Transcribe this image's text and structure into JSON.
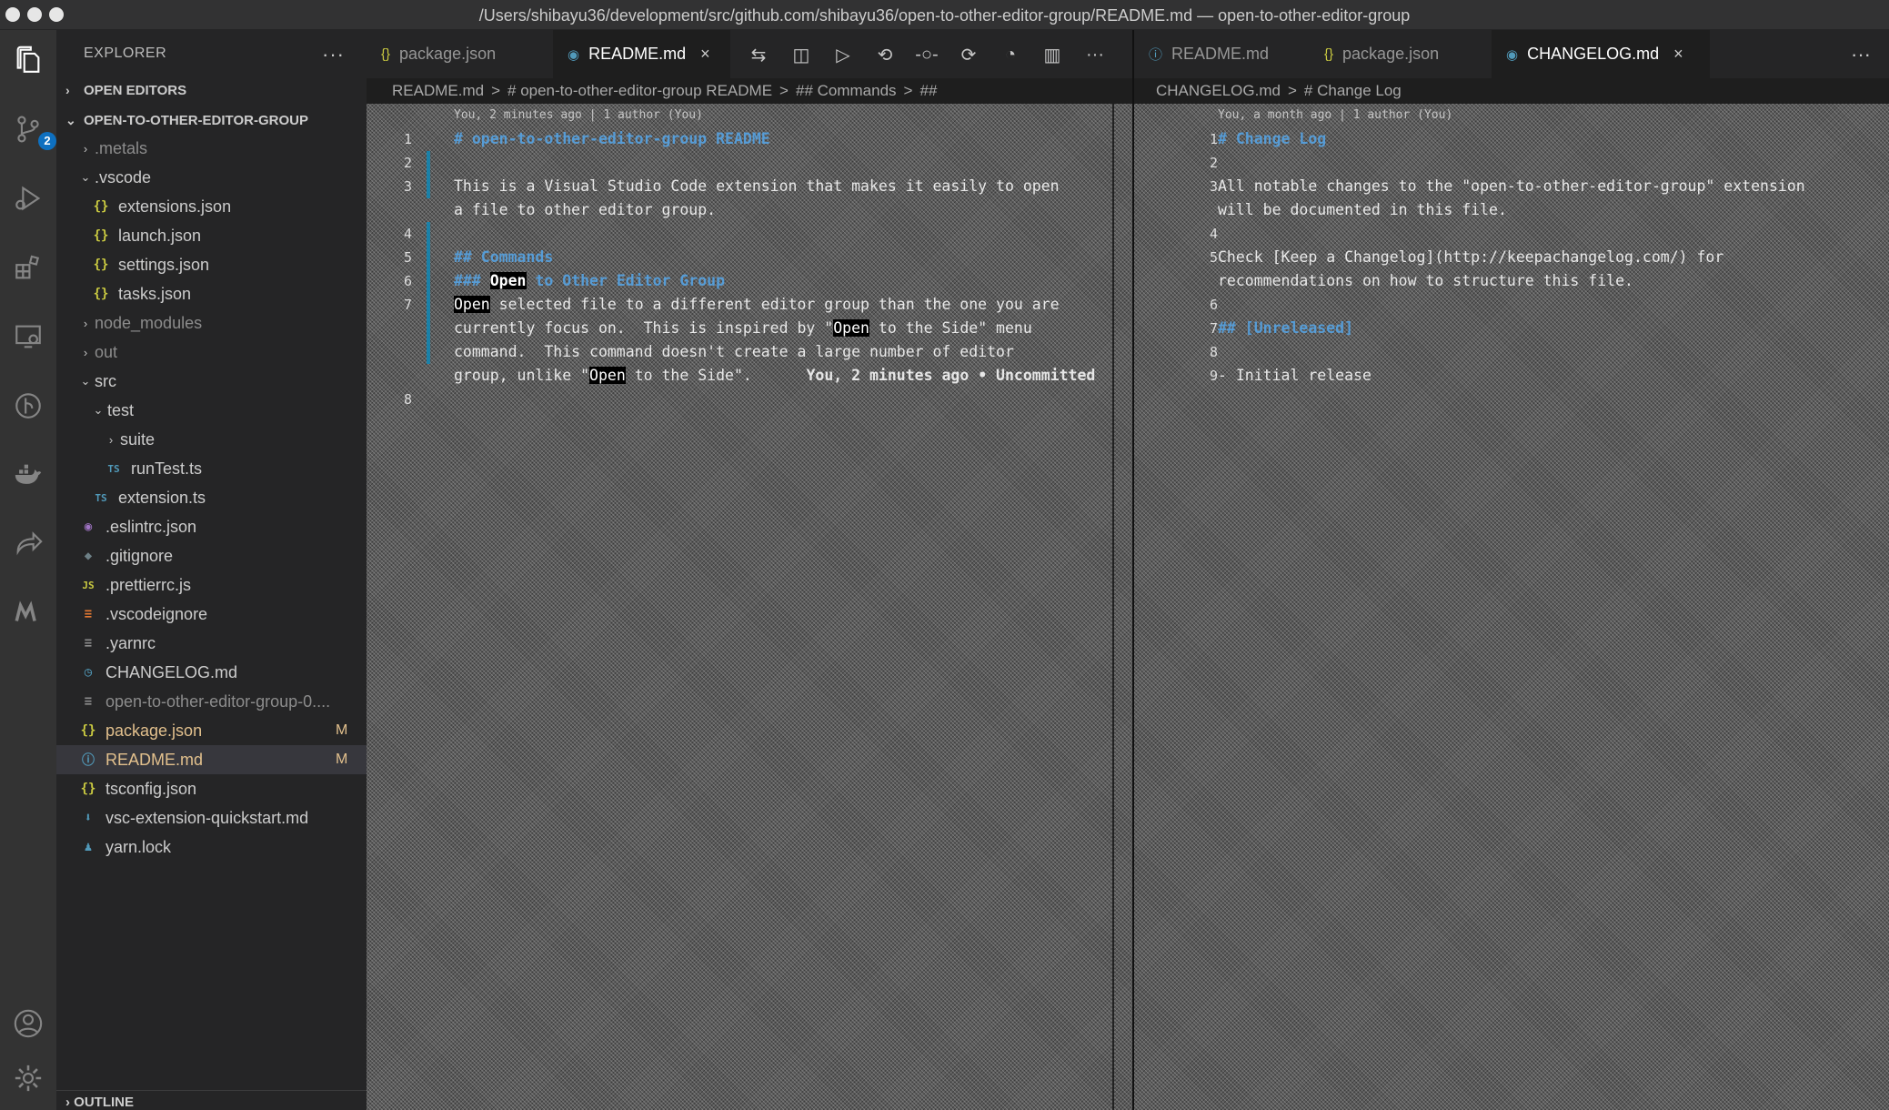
{
  "window": {
    "title": "/Users/shibayu36/development/src/github.com/shibayu36/open-to-other-editor-group/README.md — open-to-other-editor-group"
  },
  "activity_bar": {
    "scm_badge": "2",
    "icons": [
      "files-icon",
      "source-control-icon",
      "run-debug-icon",
      "extensions-icon",
      "remote-explorer-icon",
      "gitlens-icon",
      "docker-icon",
      "live-share-icon",
      "markdown-icon",
      "account-icon",
      "settings-gear-icon"
    ]
  },
  "sidebar": {
    "header": "EXPLORER",
    "more": "···",
    "open_editors": "OPEN EDITORS",
    "folder": "OPEN-TO-OTHER-EDITOR-GROUP",
    "outline": "OUTLINE",
    "tree": [
      {
        "label": ".metals",
        "indent": 1,
        "kind": "folder",
        "twisty": "›",
        "icon": "",
        "muted": true,
        "status": ""
      },
      {
        "label": ".vscode",
        "indent": 1,
        "kind": "folder",
        "twisty": "⌄",
        "icon": "",
        "muted": false,
        "status": ""
      },
      {
        "label": "extensions.json",
        "indent": 2,
        "kind": "json",
        "twisty": "",
        "icon": "{}",
        "muted": false,
        "status": ""
      },
      {
        "label": "launch.json",
        "indent": 2,
        "kind": "json",
        "twisty": "",
        "icon": "{}",
        "muted": false,
        "status": ""
      },
      {
        "label": "settings.json",
        "indent": 2,
        "kind": "json",
        "twisty": "",
        "icon": "{}",
        "muted": false,
        "status": ""
      },
      {
        "label": "tasks.json",
        "indent": 2,
        "kind": "json",
        "twisty": "",
        "icon": "{}",
        "muted": false,
        "status": ""
      },
      {
        "label": "node_modules",
        "indent": 1,
        "kind": "folder",
        "twisty": "›",
        "icon": "",
        "muted": true,
        "status": ""
      },
      {
        "label": "out",
        "indent": 1,
        "kind": "folder",
        "twisty": "›",
        "icon": "",
        "muted": true,
        "status": ""
      },
      {
        "label": "src",
        "indent": 1,
        "kind": "folder",
        "twisty": "⌄",
        "icon": "",
        "muted": false,
        "status": ""
      },
      {
        "label": "test",
        "indent": 2,
        "kind": "folder",
        "twisty": "⌄",
        "icon": "",
        "muted": false,
        "status": ""
      },
      {
        "label": "suite",
        "indent": 3,
        "kind": "folder",
        "twisty": "›",
        "icon": "",
        "muted": false,
        "status": ""
      },
      {
        "label": "runTest.ts",
        "indent": 3,
        "kind": "ts",
        "twisty": "",
        "icon": "TS",
        "muted": false,
        "status": ""
      },
      {
        "label": "extension.ts",
        "indent": 2,
        "kind": "ts",
        "twisty": "",
        "icon": "TS",
        "muted": false,
        "status": ""
      },
      {
        "label": ".eslintrc.json",
        "indent": 1,
        "kind": "eslint",
        "twisty": "",
        "icon": "◉",
        "muted": false,
        "status": ""
      },
      {
        "label": ".gitignore",
        "indent": 1,
        "kind": "git",
        "twisty": "",
        "icon": "◆",
        "muted": false,
        "status": ""
      },
      {
        "label": ".prettierrc.js",
        "indent": 1,
        "kind": "js",
        "twisty": "",
        "icon": "JS",
        "muted": false,
        "status": ""
      },
      {
        "label": ".vscodeignore",
        "indent": 1,
        "kind": "vscode",
        "twisty": "",
        "icon": "≡",
        "muted": false,
        "status": ""
      },
      {
        "label": ".yarnrc",
        "indent": 1,
        "kind": "text",
        "twisty": "",
        "icon": "≡",
        "muted": false,
        "status": ""
      },
      {
        "label": "CHANGELOG.md",
        "indent": 1,
        "kind": "changelog",
        "twisty": "",
        "icon": "◷",
        "muted": false,
        "status": ""
      },
      {
        "label": "open-to-other-editor-group-0....",
        "indent": 1,
        "kind": "text",
        "twisty": "",
        "icon": "≡",
        "muted": true,
        "status": ""
      },
      {
        "label": "package.json",
        "indent": 1,
        "kind": "json",
        "twisty": "",
        "icon": "{}",
        "muted": false,
        "status": "M"
      },
      {
        "label": "README.md",
        "indent": 1,
        "kind": "info",
        "twisty": "",
        "icon": "ⓘ",
        "muted": false,
        "status": "M",
        "selected": true
      },
      {
        "label": "tsconfig.json",
        "indent": 1,
        "kind": "json",
        "twisty": "",
        "icon": "{}",
        "muted": false,
        "status": ""
      },
      {
        "label": "vsc-extension-quickstart.md",
        "indent": 1,
        "kind": "md",
        "twisty": "",
        "icon": "⬇",
        "muted": false,
        "status": ""
      },
      {
        "label": "yarn.lock",
        "indent": 1,
        "kind": "yarn",
        "twisty": "",
        "icon": "♟",
        "muted": false,
        "status": ""
      }
    ]
  },
  "left_group": {
    "tabs": [
      {
        "label": "package.json",
        "icon": "{}",
        "active": false
      },
      {
        "label": "README.md",
        "icon": "◉",
        "active": true,
        "close": "×"
      }
    ],
    "toolbar": [
      "compare-changes-icon",
      "open-preview-icon",
      "run-icon",
      "go-back-icon",
      "commit-icon",
      "go-forward-icon",
      "timeline-icon",
      "split-editor-icon",
      "more-actions-icon"
    ],
    "toolbar_more": "···",
    "breadcrumbs": [
      "README.md",
      ">",
      "# open-to-other-editor-group README",
      ">",
      "## Commands",
      ">",
      "##"
    ],
    "lines": [
      {
        "n": "",
        "text": "You, 2 minutes ago | 1 author (You)",
        "cls": "c-text"
      },
      {
        "n": "1",
        "text": "# open-to-other-editor-group README",
        "cls": "c-head"
      },
      {
        "n": "2",
        "text": "",
        "cls": "c-text"
      },
      {
        "n": "3",
        "text": "This is a Visual Studio Code extension that makes it easily to open",
        "cls": "c-text"
      },
      {
        "n": "",
        "text": "a file to other editor group.",
        "cls": "c-text"
      },
      {
        "n": "4",
        "text": "",
        "cls": "c-text"
      },
      {
        "n": "5",
        "text": "## Commands",
        "cls": "c-head"
      },
      {
        "n": "6",
        "text": "### Open to Other Editor Group",
        "cls": "c-head"
      },
      {
        "n": "7",
        "text": "Open selected file to a different editor group than the one you are",
        "cls": "c-text"
      },
      {
        "n": "",
        "text": "currently focus on.  This is inspired by \"Open to the Side\" menu",
        "cls": "c-text"
      },
      {
        "n": "",
        "text": "command.  This command doesn't create a large number of editor",
        "cls": "c-text"
      },
      {
        "n": "",
        "text": "group, unlike \"Open to the Side\".",
        "cls": "c-text",
        "blame": "You, 2 minutes ago • Uncommitted"
      },
      {
        "n": "8",
        "text": "",
        "cls": "c-text"
      }
    ]
  },
  "right_group": {
    "tabs": [
      {
        "label": "README.md",
        "icon": "ⓘ",
        "active": false
      },
      {
        "label": "package.json",
        "icon": "{}",
        "active": false
      },
      {
        "label": "CHANGELOG.md",
        "icon": "◉",
        "active": true,
        "close": "×"
      }
    ],
    "more": "···",
    "breadcrumbs": [
      "CHANGELOG.md",
      ">",
      "# Change Log"
    ],
    "lines": [
      {
        "n": "",
        "text": "You, a month ago | 1 author (You)",
        "cls": "c-text"
      },
      {
        "n": "1",
        "text": "# Change Log",
        "cls": "c-head"
      },
      {
        "n": "2",
        "text": "",
        "cls": "c-text"
      },
      {
        "n": "3",
        "text": "All notable changes to the \"open-to-other-editor-group\" extension",
        "cls": "c-text"
      },
      {
        "n": "",
        "text": "will be documented in this file.",
        "cls": "c-text"
      },
      {
        "n": "4",
        "text": "",
        "cls": "c-text"
      },
      {
        "n": "5",
        "text": "Check [Keep a Changelog](http://keepachangelog.com/) for",
        "cls": "c-text"
      },
      {
        "n": "",
        "text": "recommendations on how to structure this file.",
        "cls": "c-text"
      },
      {
        "n": "6",
        "text": "",
        "cls": "c-text"
      },
      {
        "n": "7",
        "text": "## [Unreleased]",
        "cls": "c-head"
      },
      {
        "n": "8",
        "text": "",
        "cls": "c-text"
      },
      {
        "n": "9",
        "text": "- Initial release",
        "cls": "c-text"
      }
    ]
  },
  "colors": {
    "accent": "#0e70c0",
    "modified": "#e2c08d",
    "json_icon": "#cbcb41",
    "ts_icon": "#519aba",
    "heading": "#569cd6"
  }
}
